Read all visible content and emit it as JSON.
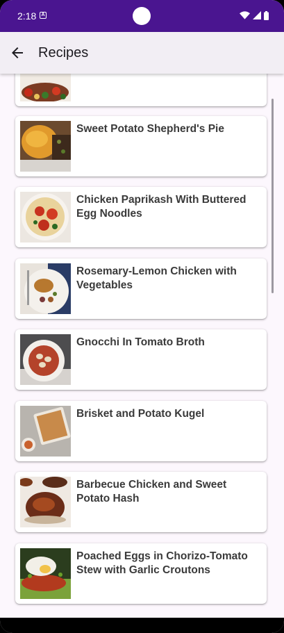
{
  "status_bar": {
    "time": "2:18",
    "notification_icon": "A"
  },
  "app_bar": {
    "title": "Recipes",
    "back_icon": "arrow-back-icon"
  },
  "recipes": [
    {
      "title": ""
    },
    {
      "title": "Sweet Potato Shepherd's Pie"
    },
    {
      "title": "Chicken Paprikash With Buttered Egg Noodles"
    },
    {
      "title": "Rosemary-Lemon Chicken with Vegetables"
    },
    {
      "title": "Gnocchi In Tomato Broth"
    },
    {
      "title": "Brisket and Potato Kugel"
    },
    {
      "title": "Barbecue Chicken and Sweet Potato Hash"
    },
    {
      "title": "Poached Eggs in Chorizo-Tomato Stew with Garlic Croutons"
    }
  ],
  "colors": {
    "status_bar": "#4a1590",
    "app_bar": "#f2eef4",
    "background": "#fcf7fd"
  }
}
